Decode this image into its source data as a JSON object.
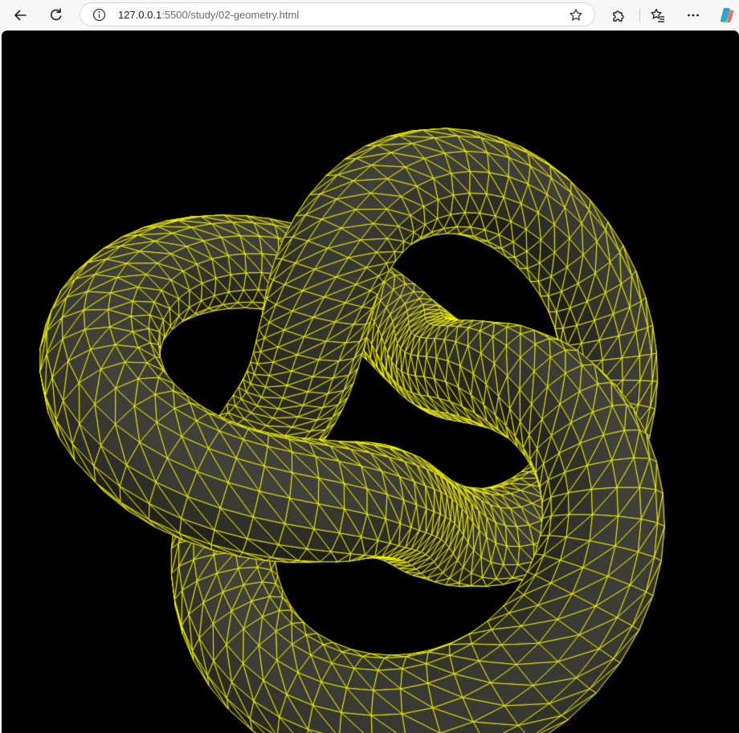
{
  "browser": {
    "url_host": "127.0.0.1",
    "url_rest": ":5500/study/02-geometry.html",
    "icons": {
      "back": "back-arrow-icon",
      "refresh": "refresh-icon",
      "info": "info-icon",
      "favorite": "star-icon",
      "extensions": "puzzle-icon",
      "favorites": "favorites-icon",
      "more": "more-icon",
      "copilot": "copilot-icon"
    }
  },
  "scene": {
    "object": "torus-knot",
    "p": 2,
    "q": 3,
    "material": "wireframe",
    "wire_color": "#ffff00",
    "surface_color": "#2b2b26",
    "background": "#000000"
  }
}
